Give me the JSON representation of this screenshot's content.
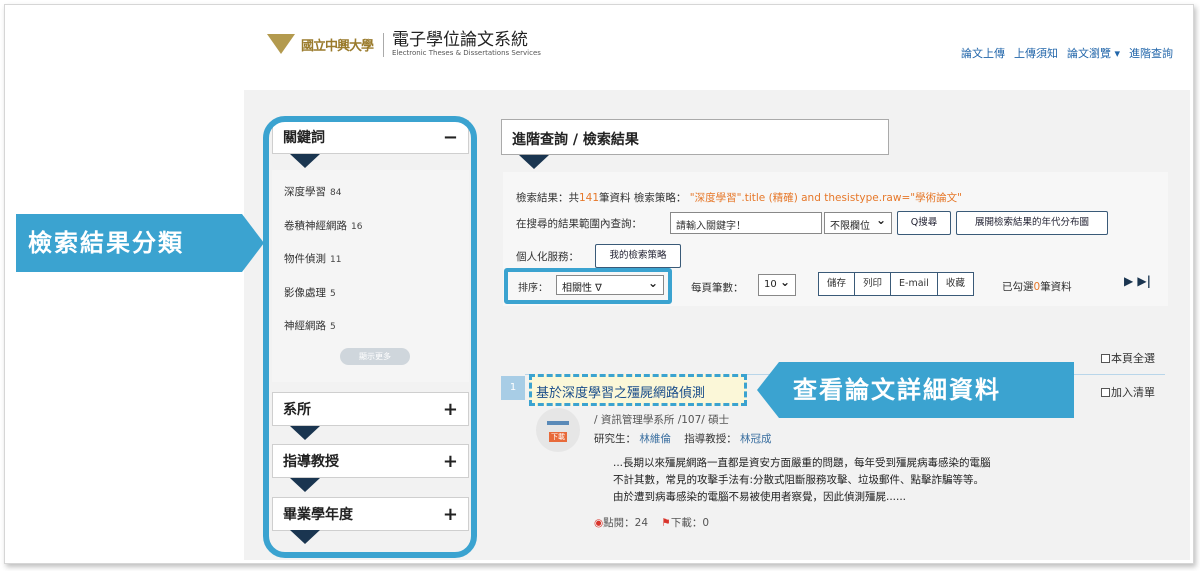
{
  "header": {
    "school_name": "國立中興大學",
    "system_title": "電子學位論文系統",
    "system_subtitle": "Electronic Theses & Dissertations Services",
    "nav": [
      "論文上傳",
      "上傳須知",
      "論文瀏覽 ▾",
      "進階查詢"
    ]
  },
  "sidebar": {
    "facets": [
      {
        "label": "關鍵詞",
        "toggle": "−"
      },
      {
        "label": "系所",
        "toggle": "+"
      },
      {
        "label": "指導教授",
        "toggle": "+"
      },
      {
        "label": "畢業學年度",
        "toggle": "+"
      }
    ],
    "keywords": [
      {
        "label": "深度學習",
        "count": "84"
      },
      {
        "label": "卷積神經網路",
        "count": "16"
      },
      {
        "label": "物件偵測",
        "count": "11"
      },
      {
        "label": "影像處理",
        "count": "5"
      },
      {
        "label": "神經網路",
        "count": "5"
      }
    ],
    "more_label": "顯示更多"
  },
  "annotations": {
    "left_callout": "檢索結果分類",
    "right_callout": "查看論文詳細資料"
  },
  "results": {
    "header": "進階查詢 / 檢索結果",
    "summary_prefix": "檢索結果：共",
    "summary_count": "141",
    "summary_mid": "筆資料 檢索策略：",
    "summary_strategy": "\"深度學習\".title (精確) and thesistype.raw=\"學術論文\"",
    "refine_label": "在搜尋的結果範圍內查詢：",
    "refine_placeholder": "請輸入關鍵字！",
    "field_select": "不限欄位",
    "search_button": "Q搜尋",
    "distribution_button": "展開檢索結果的年代分布圖",
    "personal_label": "個人化服務：",
    "strategy_button": "我的檢索策略",
    "sort_label": "排序：",
    "sort_value": "相關性 ∇",
    "perpage_label": "每頁筆數：",
    "perpage_value": "10",
    "actions": [
      "儲存",
      "列印",
      "E-mail",
      "收藏"
    ],
    "checked_prefix": "已勾選",
    "checked_count": "0",
    "checked_suffix": "筆資料",
    "pager": "▶ ▶|",
    "select_all": "本頁全選",
    "add_list": "加入清單"
  },
  "record": {
    "index": "1",
    "title": "基於深度學習之殭屍網路偵測",
    "download_label": "下載",
    "dept_line": "/ 資訊管理學系所 /107/ 碩士",
    "researcher_label": "研究生：",
    "researcher": "林維倫",
    "advisor_label": "指導教授：",
    "advisor": "林冠成",
    "abstract_lines": [
      "...長期以來殭屍網路一直都是資安方面嚴重的問題，每年受到殭屍病毒感染的電腦",
      "不計其數，常見的攻擊手法有:分散式阻斷服務攻擊、垃圾郵件、點擊詐騙等等。",
      "由於遭到病毒感染的電腦不易被使用者察覺，因此偵測殭屍......"
    ],
    "views": "點閱：24",
    "downloads": "下載：0"
  }
}
